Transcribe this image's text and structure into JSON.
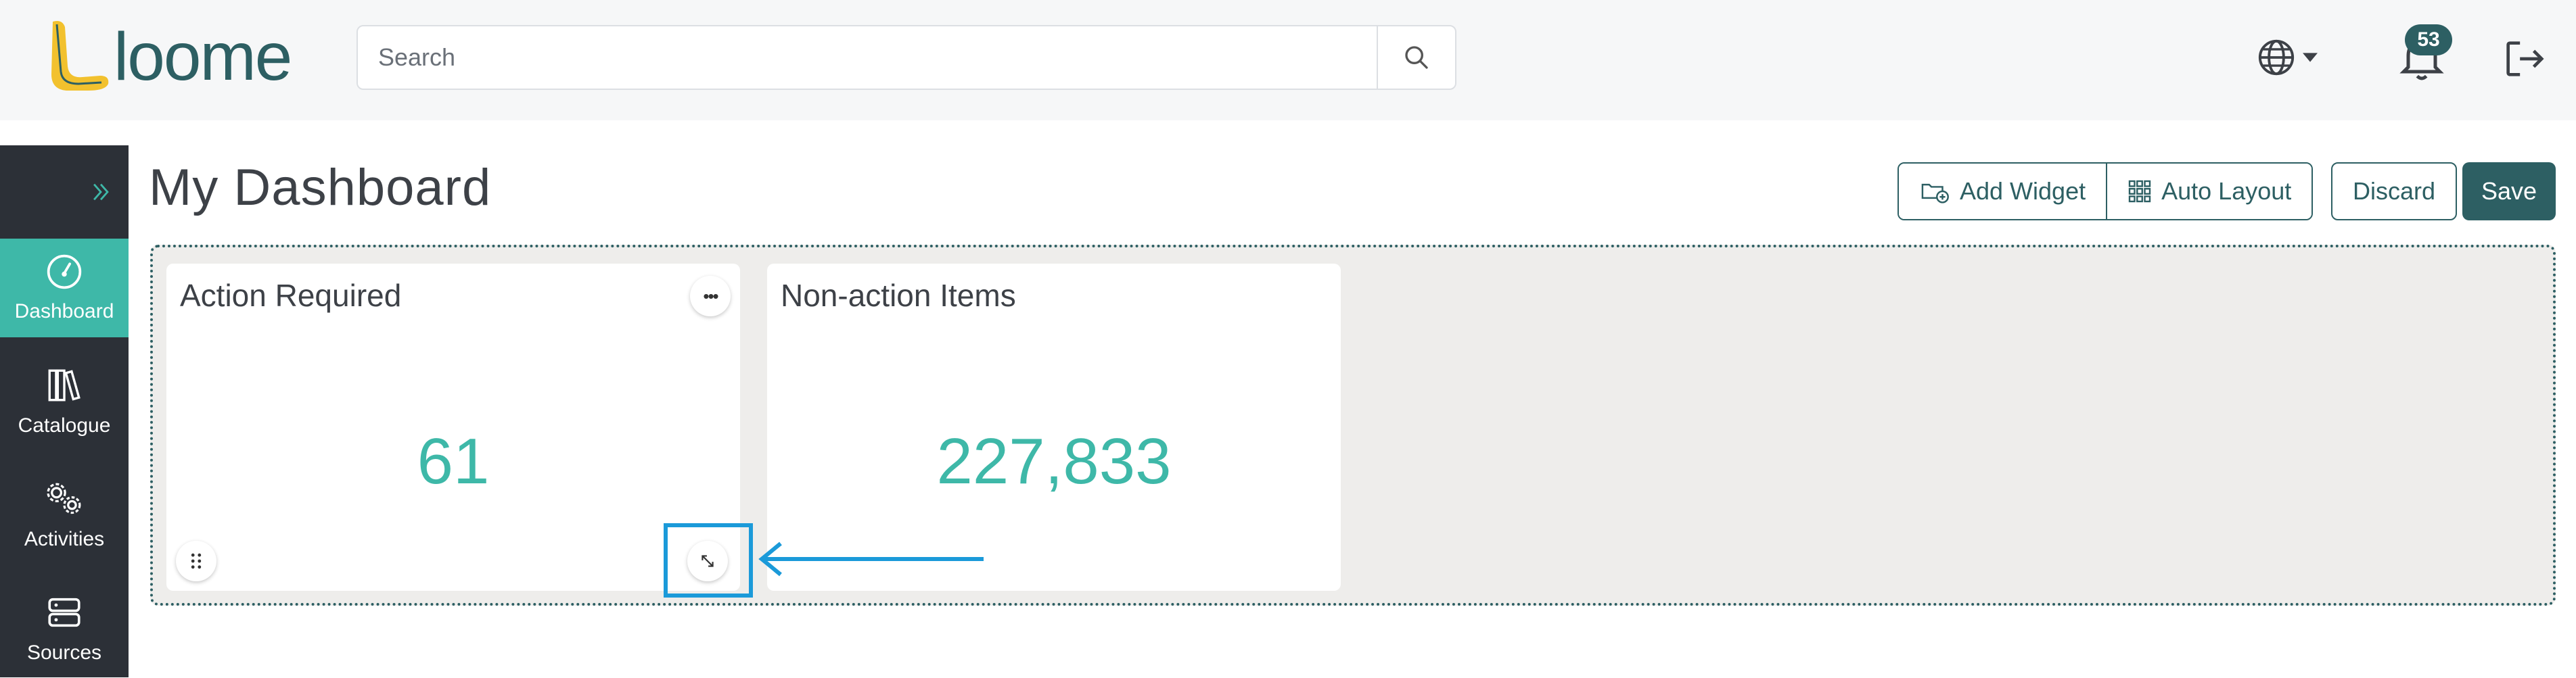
{
  "app": {
    "logo_text": "loome",
    "colors": {
      "brand_dark": "#2d5f63",
      "accent_teal": "#3eb8a8",
      "logo_yellow": "#f2c12e",
      "sidebar_bg": "#2c3037",
      "annotation_blue": "#1b9ad9"
    }
  },
  "header": {
    "search": {
      "placeholder": "Search",
      "value": "",
      "icon": "search-icon"
    },
    "language_icon": "globe-icon",
    "notifications": {
      "icon": "bell-icon",
      "count": "53"
    },
    "logout_icon": "logout-icon"
  },
  "sidebar": {
    "toggle_icon": "double-chevron-right-icon",
    "items": [
      {
        "label": "Dashboard",
        "icon": "dashboard-icon",
        "active": true
      },
      {
        "label": "Catalogue",
        "icon": "books-icon",
        "active": false
      },
      {
        "label": "Activities",
        "icon": "gears-icon",
        "active": false
      },
      {
        "label": "Sources",
        "icon": "server-icon",
        "active": false
      }
    ]
  },
  "page": {
    "title": "My Dashboard",
    "toolbar": {
      "add_widget_label": "Add Widget",
      "auto_layout_label": "Auto Layout",
      "discard_label": "Discard",
      "save_label": "Save"
    }
  },
  "widgets": [
    {
      "title": "Action Required",
      "value": "61",
      "has_menu": true
    },
    {
      "title": "Non-action Items",
      "value": "227,833",
      "has_menu": false
    }
  ],
  "annotation": {
    "target": "resize-handle",
    "style": "highlight box with left-pointing arrow"
  }
}
